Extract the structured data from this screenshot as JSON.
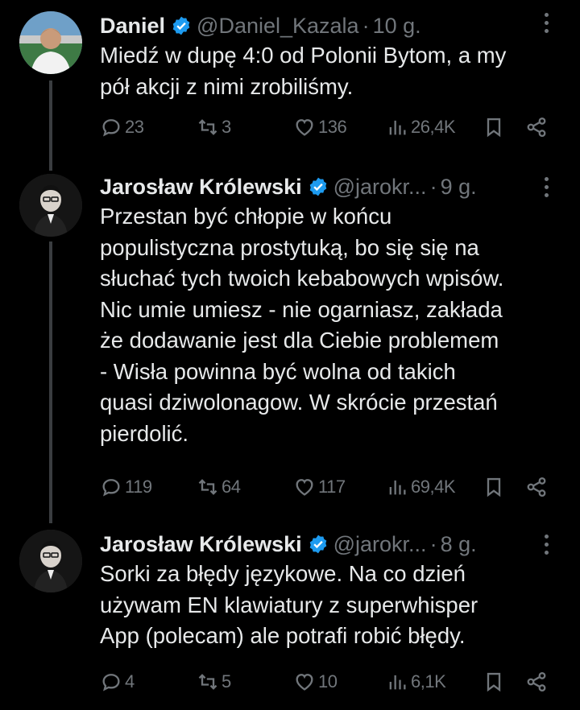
{
  "tweets": [
    {
      "author": "Daniel",
      "handle": "@Daniel_Kazala",
      "dot": "·",
      "time": "10 g.",
      "text": "Miedź w dupę 4:0 od Polonii Bytom, a my\npół akcji z nimi zrobiliśmy.",
      "replies": "23",
      "reposts": "3",
      "likes": "136",
      "views": "26,4K"
    },
    {
      "author": "Jarosław Królewski",
      "handle": "@jarokr...",
      "dot": "·",
      "time": "9 g.",
      "text": "Przestan być chłopie w końcu\npopulistyczna prostytuką, bo się się na\nsłuchać tych twoich kebabowych wpisów.\nNic umie umiesz -  nie ogarniasz, zakłada\nże dodawanie jest dla Ciebie problemem\n- Wisła powinna być wolna od takich\nquasi dziwolonagow. W skrócie przestań\npierdolić.",
      "replies": "119",
      "reposts": "64",
      "likes": "117",
      "views": "69,4K"
    },
    {
      "author": "Jarosław Królewski",
      "handle": "@jarokr...",
      "dot": "·",
      "time": "8 g.",
      "text": "Sorki za błędy językowe. Na co dzień\nużywam EN klawiatury z superwhisper\nApp (polecam) ale potrafi robić błędy.",
      "replies": "4",
      "reposts": "5",
      "likes": "10",
      "views": "6,1K"
    }
  ],
  "colors": {
    "background": "#000000",
    "text": "#e7e9ea",
    "muted": "#71767b",
    "verified": "#1d9bf0"
  },
  "icons": [
    "verified-badge-icon",
    "more-icon",
    "reply-icon",
    "repost-icon",
    "like-icon",
    "views-icon",
    "bookmark-icon",
    "share-icon"
  ]
}
